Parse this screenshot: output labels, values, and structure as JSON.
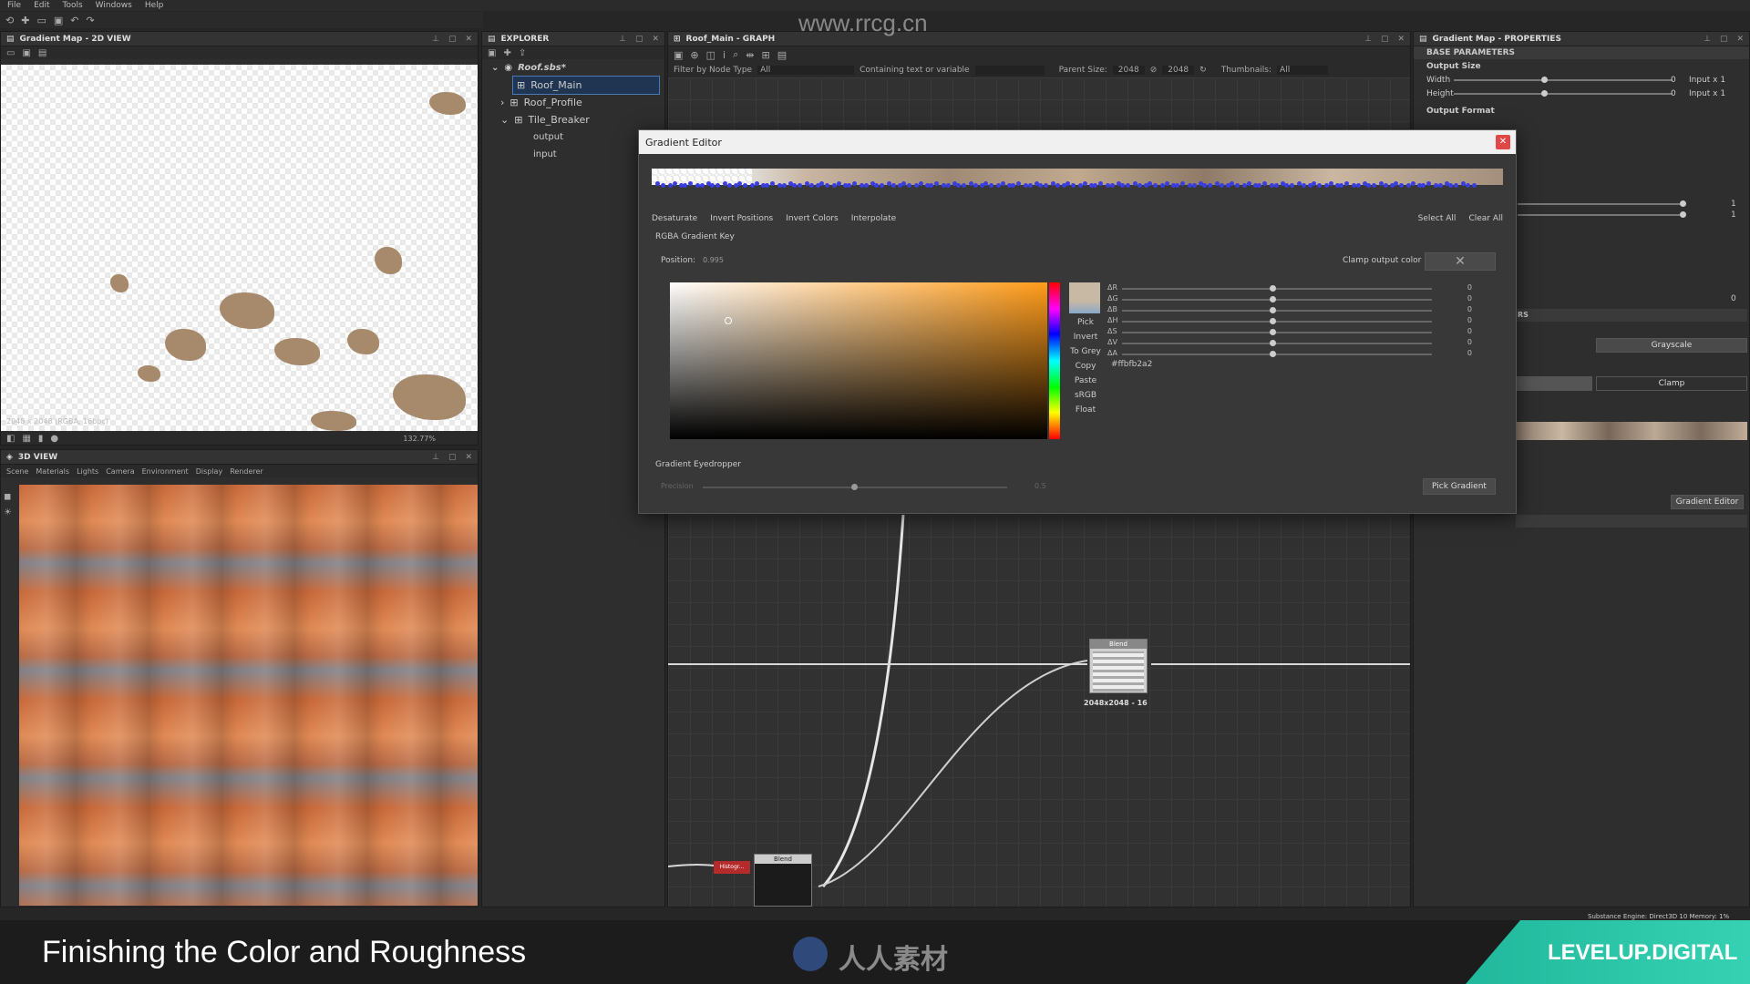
{
  "watermark_url": "www.rrcg.cn",
  "menu": [
    "File",
    "Edit",
    "Tools",
    "Windows",
    "Help"
  ],
  "view2d": {
    "title": "Gradient Map - 2D VIEW",
    "info": "2048 x 2048 (RGBA, 16bpc)",
    "zoom": "132.77%"
  },
  "view3d": {
    "title": "3D VIEW",
    "menu": [
      "Scene",
      "Materials",
      "Lights",
      "Camera",
      "Environment",
      "Display",
      "Renderer"
    ]
  },
  "explorer": {
    "title": "EXPLORER",
    "root": "Roof.sbs*",
    "items": [
      {
        "label": "Roof_Main",
        "expanded": false,
        "selected": true
      },
      {
        "label": "Roof_Profile",
        "expanded": false,
        "selected": false
      },
      {
        "label": "Tile_Breaker",
        "expanded": true,
        "selected": false
      }
    ],
    "children": [
      "output",
      "input"
    ]
  },
  "graph": {
    "title": "Roof_Main - GRAPH",
    "filter_label": "Filter by Node Type",
    "filter_value": "All",
    "containing_label": "Containing text or variable",
    "parent_size_label": "Parent Size:",
    "parent_size_w": "2048",
    "parent_size_h": "2048",
    "thumbnails_label": "Thumbnails:",
    "thumbnails_value": "All",
    "node_blend_label": "Blend",
    "node_blend_size": "2048x2048 - 16",
    "node_blend2_label": "Blend",
    "node_histo_label": "Histogr..."
  },
  "gradient_editor": {
    "title": "Gradient Editor",
    "actions_left": [
      "Desaturate",
      "Invert Positions",
      "Invert Colors",
      "Interpolate"
    ],
    "actions_right": [
      "Select All",
      "Clear All"
    ],
    "key_label": "RGBA Gradient Key",
    "position_label": "Position:",
    "position_value": "0.995",
    "clamp_label": "Clamp output color",
    "side_options": [
      "Pick",
      "Invert",
      "To Grey",
      "Copy",
      "Paste",
      "sRGB",
      "Float"
    ],
    "channels": [
      {
        "label": "ΔR",
        "value": "0"
      },
      {
        "label": "ΔG",
        "value": "0"
      },
      {
        "label": "ΔB",
        "value": "0"
      },
      {
        "label": "ΔH",
        "value": "0"
      },
      {
        "label": "ΔS",
        "value": "0"
      },
      {
        "label": "ΔV",
        "value": "0"
      },
      {
        "label": "ΔA",
        "value": "0"
      }
    ],
    "hex": "#ffbfb2a2",
    "swatch_color": "#c8b9a4",
    "eyedropper_label": "Gradient Eyedropper",
    "precision_label": "Precision",
    "precision_value": "0.5",
    "pick_gradient": "Pick Gradient"
  },
  "properties": {
    "title": "Gradient Map - PROPERTIES",
    "section": "BASE PARAMETERS",
    "output_size": "Output Size",
    "width_label": "Width",
    "width_value": "0",
    "width_mode": "Input x 1",
    "height_label": "Height",
    "height_value": "0",
    "height_mode": "Input x 1",
    "output_format": "Output Format",
    "val_1a": "1",
    "val_1b": "1",
    "val_0": "0",
    "section2_suffix": "RS",
    "grayscale_btn": "Grayscale",
    "clamp_btn": "Clamp",
    "gradient_editor_btn": "Gradient Editor"
  },
  "status": "Substance Engine: Direct3D 10  Memory: 1%",
  "footer": {
    "title": "Finishing the Color and Roughness",
    "center_logo": "人人素材",
    "brand": "LEVELUP.DIGITAL"
  }
}
